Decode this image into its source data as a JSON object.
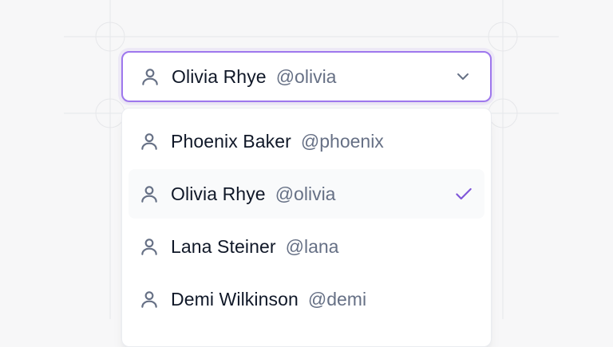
{
  "select": {
    "selected_name": "Olivia Rhye",
    "selected_handle": "@olivia",
    "icon": "user-icon",
    "chevron_icon": "chevron-down-icon",
    "accent_color": "#9e77ed"
  },
  "options": [
    {
      "name": "Phoenix Baker",
      "handle": "@phoenix",
      "selected": false
    },
    {
      "name": "Olivia Rhye",
      "handle": "@olivia",
      "selected": true
    },
    {
      "name": "Lana Steiner",
      "handle": "@lana",
      "selected": false
    },
    {
      "name": "Demi Wilkinson",
      "handle": "@demi",
      "selected": false
    }
  ],
  "check_icon": "check-icon",
  "check_color": "#7f56d9"
}
